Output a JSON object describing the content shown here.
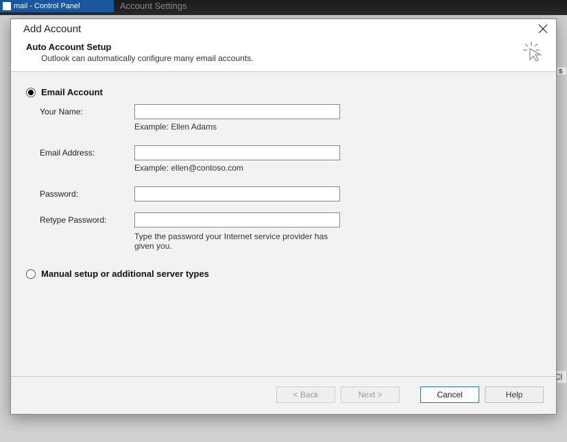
{
  "background": {
    "window_title": "mail - Control Panel",
    "ghost_tab": "Account Settings",
    "truncated_button": "Cl",
    "truncated_button2": "s"
  },
  "dialog": {
    "title": "Add Account",
    "header": {
      "title": "Auto Account Setup",
      "subtitle": "Outlook can automatically configure many email accounts."
    },
    "options": {
      "email_account": "Email Account",
      "manual_setup": "Manual setup or additional server types"
    },
    "fields": {
      "your_name_label": "Your Name:",
      "your_name_value": "",
      "your_name_hint": "Example: Ellen Adams",
      "email_label": "Email Address:",
      "email_value": "",
      "email_hint": "Example: ellen@contoso.com",
      "password_label": "Password:",
      "password_value": "",
      "retype_label": "Retype Password:",
      "retype_value": "",
      "password_hint": "Type the password your Internet service provider has given you."
    },
    "buttons": {
      "back": "< Back",
      "next": "Next >",
      "cancel": "Cancel",
      "help": "Help"
    }
  }
}
